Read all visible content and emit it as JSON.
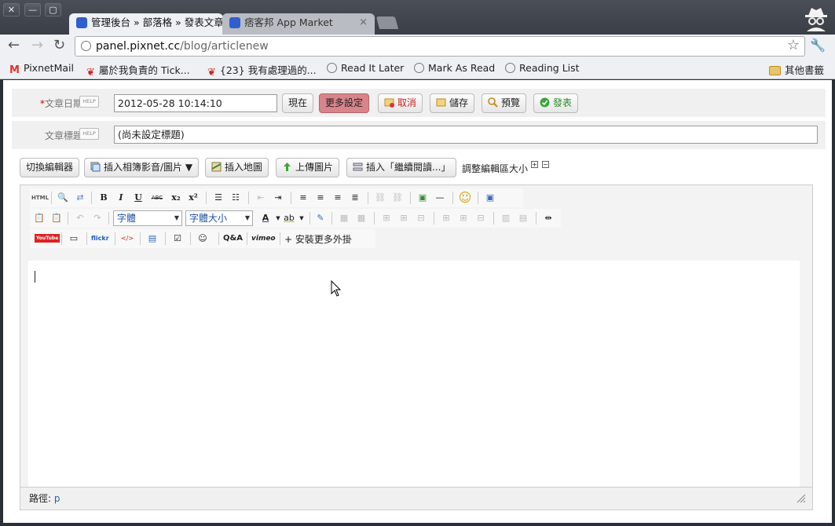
{
  "tabs": [
    {
      "label": "管理後台 » 部落格 » 發表文章",
      "active": true
    },
    {
      "label": "痞客邦 App Market",
      "active": false
    }
  ],
  "address": {
    "domain": "panel.pixnet.cc",
    "path": "/blog/articlenew"
  },
  "bookmarks": [
    {
      "label": "PixnetMail",
      "icon": "gmail-icon"
    },
    {
      "label": "屬於我負責的 Tick...",
      "icon": "paw-icon"
    },
    {
      "label": "{23} 我有處理過的...",
      "icon": "paw-icon"
    },
    {
      "label": "Read It Later",
      "icon": "globe-icon"
    },
    {
      "label": "Mark As Read",
      "icon": "globe-icon"
    },
    {
      "label": "Reading List",
      "icon": "globe-icon"
    },
    {
      "label": "其他書籤",
      "icon": "folder-icon"
    }
  ],
  "form": {
    "date_label": "文章日期",
    "date_required_mark": "*",
    "help_label": "HELP",
    "date_value": "2012-05-28 10:14:10",
    "now_button": "現在",
    "more_settings_button": "更多設定",
    "cancel_button": "取消",
    "save_button": "儲存",
    "preview_button": "預覽",
    "publish_button": "發表",
    "title_label": "文章標題",
    "title_value": "(尚未設定標題)"
  },
  "editor_actions": {
    "switch_editor": "切換編輯器",
    "insert_album": "插入相簿影音/圖片",
    "insert_map": "插入地圖",
    "upload_image": "上傳圖片",
    "insert_readmore": "插入「繼續閱讀...」",
    "resize_label": "調整編輯區大小"
  },
  "toolbar": {
    "html_label": "HTML",
    "bold": "B",
    "italic": "I",
    "underline": "U",
    "strike": "ABC",
    "subscript": "x₂",
    "superscript": "x²",
    "font_family": "字體",
    "font_size": "字體大小",
    "youtube": "YouTube",
    "flickr": "flickr",
    "qa": "Q&A",
    "vimeo": "vimeo",
    "install_plugins": "安裝更多外掛"
  },
  "status": {
    "path_label": "路徑:",
    "path_value": "p"
  },
  "colors": {
    "accent_pink": "#d9848a",
    "link_blue": "#2a62b5",
    "tab_favicon": "#2f5fd0"
  }
}
